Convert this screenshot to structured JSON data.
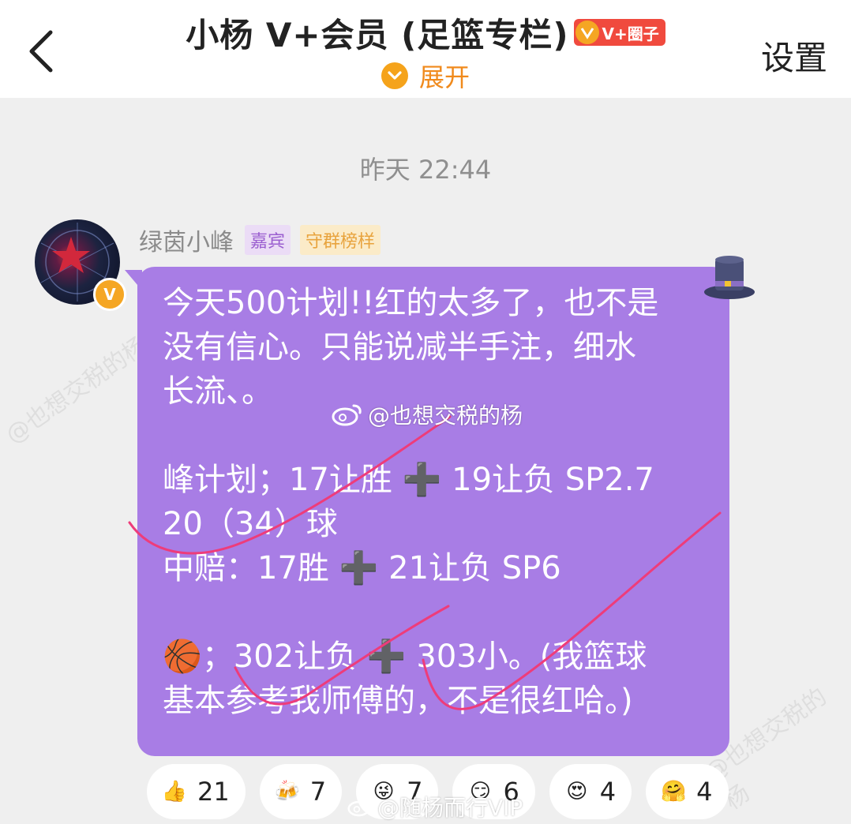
{
  "header": {
    "title": "小杨 V+会员 (足篮专栏)",
    "badge_text": "V+圈子",
    "expand_label": "展开",
    "settings_label": "设置",
    "accent_color": "#f5a31b"
  },
  "chat": {
    "timestamp": "昨天 22:44",
    "message": {
      "sender": "绿茵小峰",
      "tags": [
        "嘉宾",
        "守群榜样"
      ],
      "bubble_color": "#a87de5",
      "lines": [
        "今天500计划!!红的太多了，也不是",
        "没有信心。只能说减半手注，细水",
        "长流、。",
        "",
        "峰计划；17让胜 ➕ 19让负 SP2.7",
        "20（34）球",
        "中赔：17胜 ➕ 21让负 SP6",
        "",
        "🏀；302让负 ➕ 303小。(我篮球",
        "基本参考我师傅的，不是很红哈。)"
      ]
    }
  },
  "watermarks": {
    "primary": "@也想交税的杨",
    "secondary": "@随杨而行VIP",
    "faint": "@也想交税的杨"
  },
  "reactions": [
    {
      "icon": "thumbs-up-icon",
      "glyph": "👍",
      "count": "21"
    },
    {
      "icon": "beer-cheers-icon",
      "glyph": "🍻",
      "count": "7"
    },
    {
      "icon": "wink-face-icon",
      "glyph": "😜",
      "count": "7"
    },
    {
      "icon": "smirk-face-icon",
      "glyph": "😏",
      "count": "6"
    },
    {
      "icon": "heart-eyes-icon",
      "glyph": "😍",
      "count": "4"
    },
    {
      "icon": "hug-face-icon",
      "glyph": "🤗",
      "count": "4"
    }
  ]
}
